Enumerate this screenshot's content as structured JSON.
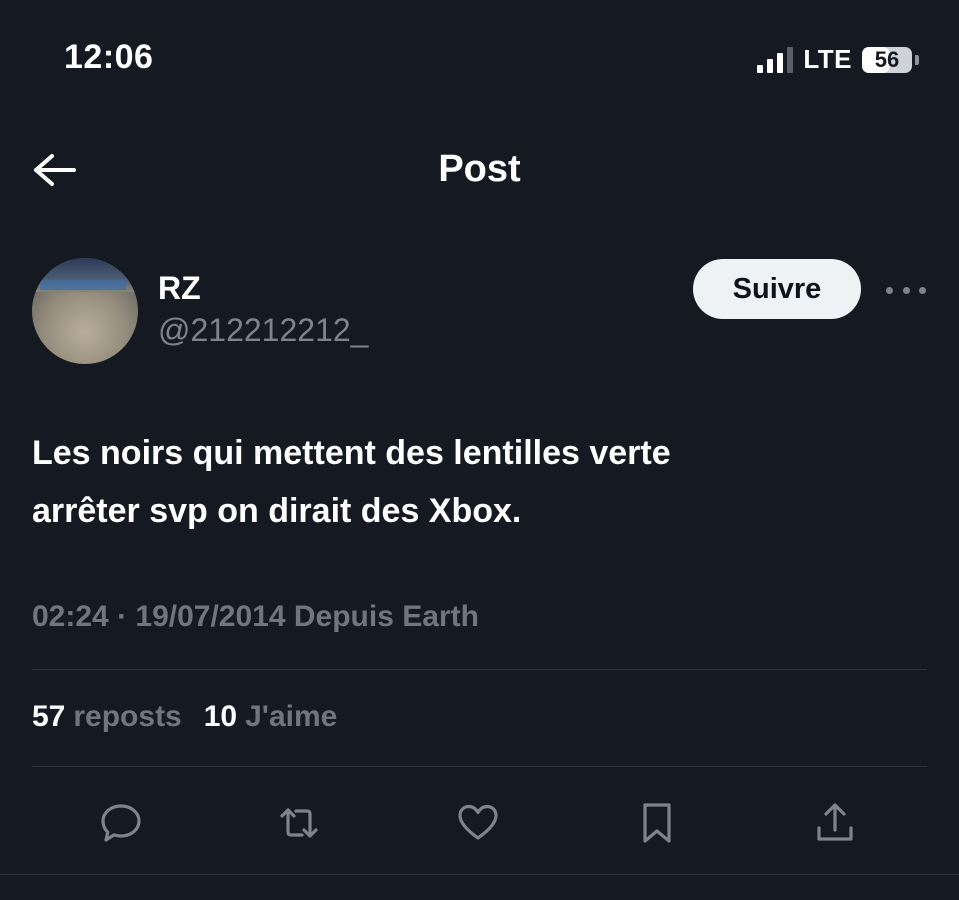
{
  "status_bar": {
    "time": "12:06",
    "network": "LTE",
    "battery": "56",
    "battery_level": 0.56,
    "signal_bars_active": 3,
    "signal_bars_total": 4
  },
  "header": {
    "title": "Post",
    "back_icon": "arrow-left-icon"
  },
  "author": {
    "display_name": "RZ",
    "handle": "@212212212_",
    "follow_label": "Suivre",
    "more_icon": "more-horizontal-icon"
  },
  "post": {
    "text_lines": [
      "Les noirs qui mettent des lentilles verte",
      "arrêter svp on dirait des Xbox."
    ],
    "meta": "02:24 · 19/07/2014 Depuis Earth"
  },
  "stats": [
    {
      "count": "57",
      "label": "reposts"
    },
    {
      "count": "10",
      "label": "J'aime"
    }
  ],
  "actions": [
    {
      "icon": "reply-icon"
    },
    {
      "icon": "repost-icon"
    },
    {
      "icon": "like-icon"
    },
    {
      "icon": "bookmark-icon"
    },
    {
      "icon": "share-icon"
    }
  ],
  "colors": {
    "background": "#151a22",
    "text_primary": "#ffffff",
    "text_secondary": "#6f767e",
    "divider": "#2d333b",
    "follow_button_bg": "#eff2f4",
    "icon": "#7d848c"
  }
}
